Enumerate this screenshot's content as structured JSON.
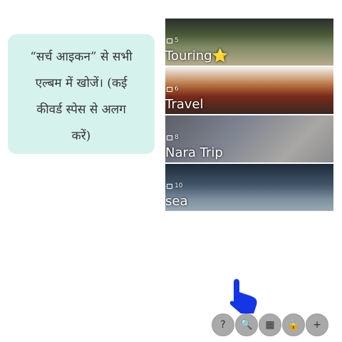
{
  "tooltip": {
    "lines": [
      "“सर्च आइकन” से सभी",
      "एल्बम में खोजें। (कई",
      "कीवर्ड स्पेस से अलग",
      "करें)"
    ]
  },
  "albums": [
    {
      "count": "5",
      "name": "Touring⭐"
    },
    {
      "count": "6",
      "name": "Travel"
    },
    {
      "count": "8",
      "name": "Nara Trip"
    },
    {
      "count": "10",
      "name": "sea"
    }
  ],
  "toolbar": {
    "help_icon": "?",
    "search_icon": "🔍",
    "view_icon": "▦",
    "lock_icon": "🔒",
    "add_icon": "+"
  },
  "colors": {
    "tooltip_bg": "#d6f2ec",
    "pointer": "#1436e6",
    "button_bg": "#a9a9a9"
  }
}
